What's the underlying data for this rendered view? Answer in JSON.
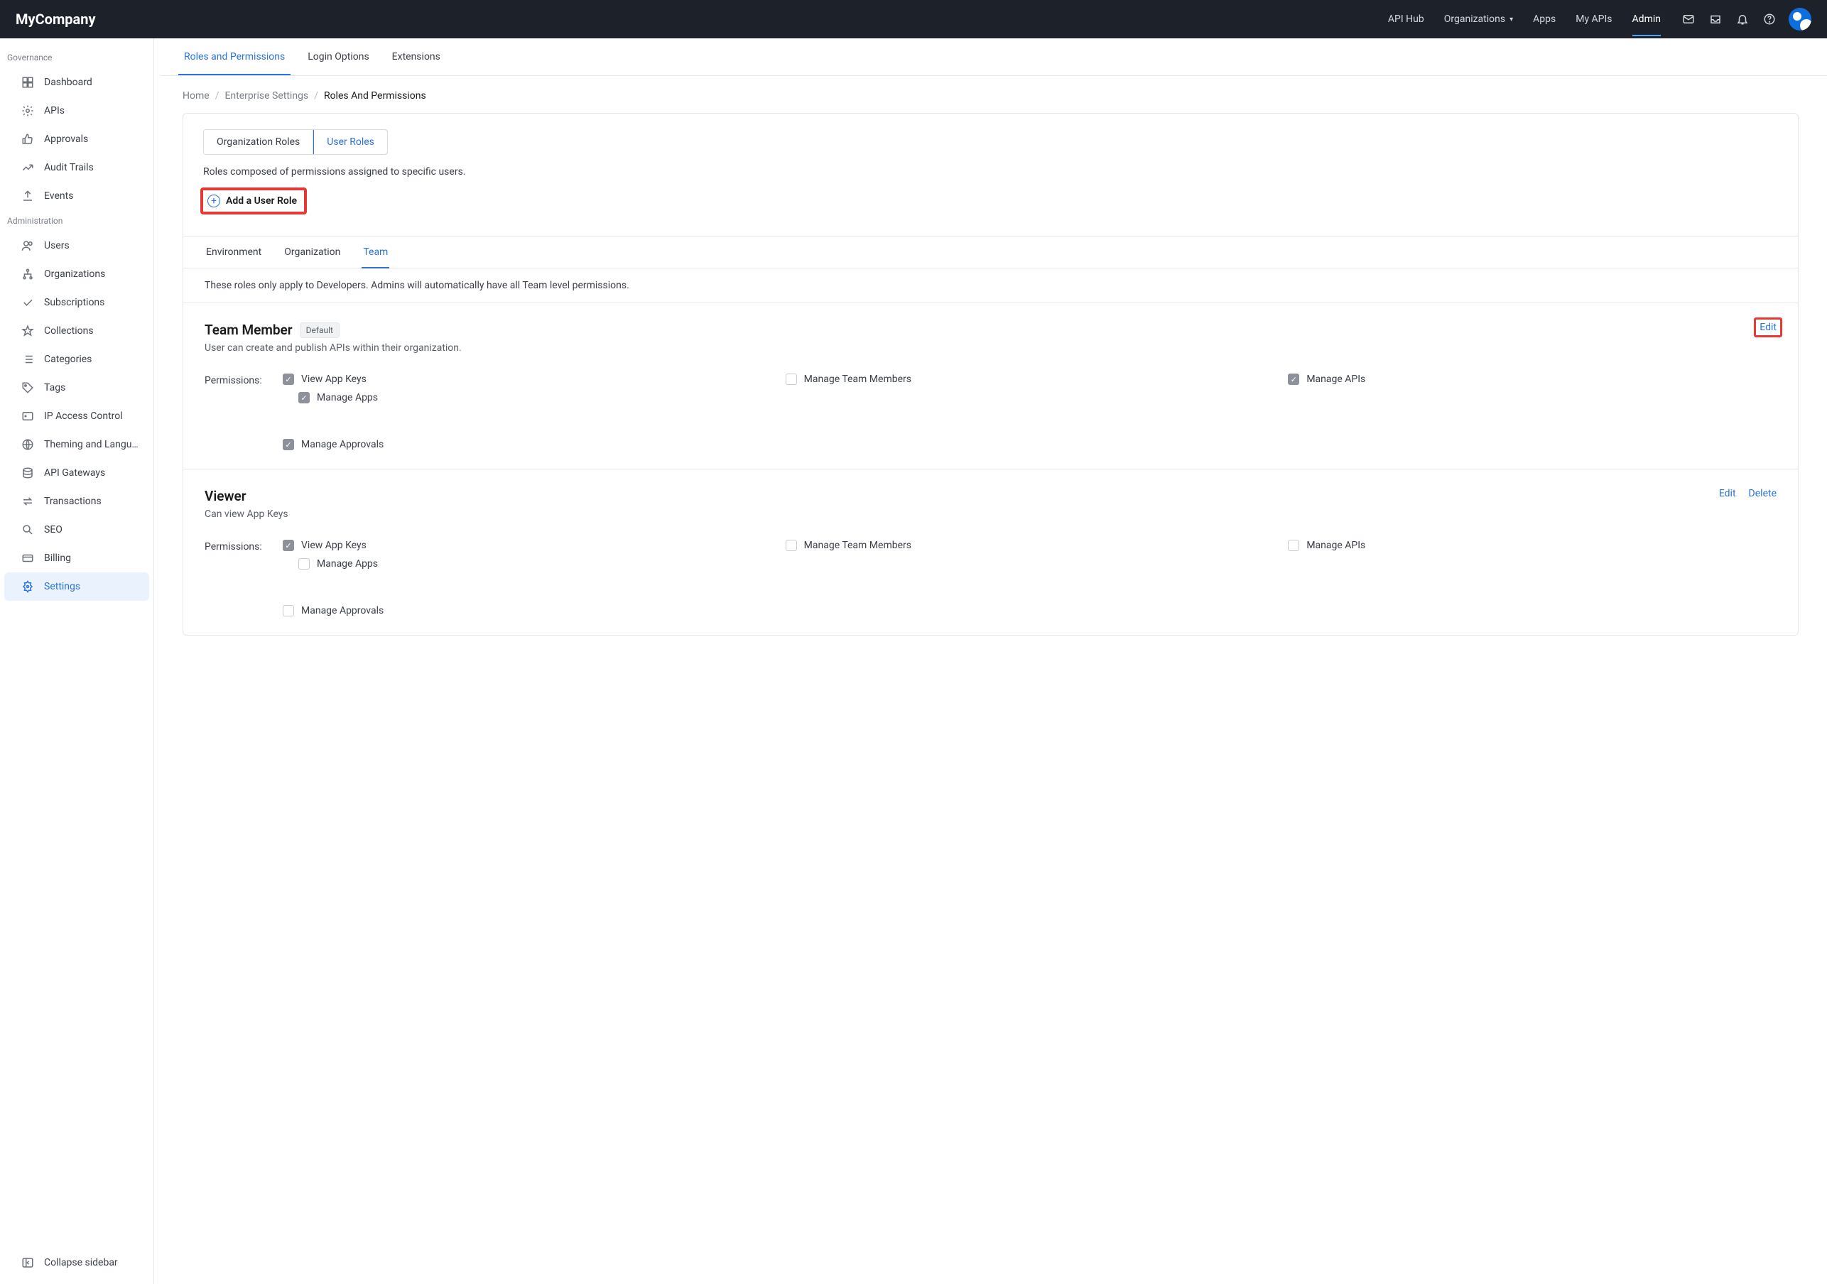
{
  "brand": "MyCompany",
  "top_nav": {
    "api_hub": "API Hub",
    "organizations": "Organizations",
    "apps": "Apps",
    "my_apis": "My APIs",
    "admin": "Admin"
  },
  "sidebar": {
    "section_governance": "Governance",
    "section_administration": "Administration",
    "governance_items": [
      {
        "label": "Dashboard"
      },
      {
        "label": "APIs"
      },
      {
        "label": "Approvals"
      },
      {
        "label": "Audit Trails"
      },
      {
        "label": "Events"
      }
    ],
    "admin_items": [
      {
        "label": "Users"
      },
      {
        "label": "Organizations"
      },
      {
        "label": "Subscriptions"
      },
      {
        "label": "Collections"
      },
      {
        "label": "Categories"
      },
      {
        "label": "Tags"
      },
      {
        "label": "IP Access Control"
      },
      {
        "label": "Theming and Langu…"
      },
      {
        "label": "API Gateways"
      },
      {
        "label": "Transactions"
      },
      {
        "label": "SEO"
      },
      {
        "label": "Billing"
      },
      {
        "label": "Settings"
      }
    ],
    "collapse": "Collapse sidebar"
  },
  "tabs": {
    "roles": "Roles and Permissions",
    "login": "Login Options",
    "extensions": "Extensions"
  },
  "breadcrumb": {
    "home": "Home",
    "ent": "Enterprise Settings",
    "current": "Roles And Permissions"
  },
  "role_type_toggle": {
    "org": "Organization Roles",
    "user": "User Roles"
  },
  "card_desc": "Roles composed of permissions assigned to specific users.",
  "add_role_label": "Add a User Role",
  "scope_tabs": {
    "env": "Environment",
    "org": "Organization",
    "team": "Team"
  },
  "scope_note": "These roles only apply to Developers. Admins will automatically have all Team level permissions.",
  "permissions_label": "Permissions:",
  "actions": {
    "edit": "Edit",
    "delete": "Delete"
  },
  "roles": [
    {
      "name": "Team Member",
      "badge": "Default",
      "desc": "User can create and publish APIs within their organization.",
      "perms": {
        "view_app_keys": {
          "label": "View App Keys",
          "checked": true
        },
        "manage_apps": {
          "label": "Manage Apps",
          "checked": true
        },
        "manage_team_members": {
          "label": "Manage Team Members",
          "checked": false
        },
        "manage_apis": {
          "label": "Manage APIs",
          "checked": true
        },
        "manage_approvals": {
          "label": "Manage Approvals",
          "checked": true
        }
      },
      "edit_highlighted": true,
      "can_delete": false
    },
    {
      "name": "Viewer",
      "badge": null,
      "desc": "Can view App Keys",
      "perms": {
        "view_app_keys": {
          "label": "View App Keys",
          "checked": true
        },
        "manage_apps": {
          "label": "Manage Apps",
          "checked": false
        },
        "manage_team_members": {
          "label": "Manage Team Members",
          "checked": false
        },
        "manage_apis": {
          "label": "Manage APIs",
          "checked": false
        },
        "manage_approvals": {
          "label": "Manage Approvals",
          "checked": false
        }
      },
      "edit_highlighted": false,
      "can_delete": true
    }
  ]
}
